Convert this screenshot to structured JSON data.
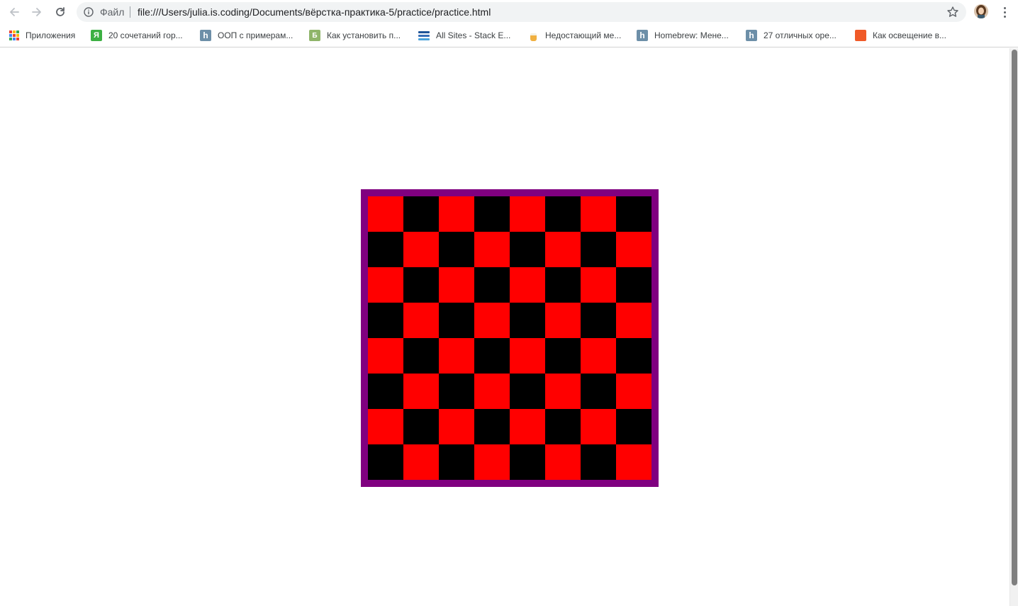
{
  "toolbar": {
    "scheme_label": "Файл",
    "url": "file:///Users/julia.is.coding/Documents/вёрстка-практика-5/practice/practice.html",
    "icons": {
      "back": "arrow-left",
      "forward": "arrow-right",
      "reload": "reload",
      "info": "info-circle",
      "bookmark": "star-outline",
      "profile": "avatar",
      "menu": "vertical-ellipsis"
    }
  },
  "bookmarks": [
    {
      "label": "Приложения",
      "icon": "apps-grid"
    },
    {
      "label": "20 сочетаний гор...",
      "icon": "green-y"
    },
    {
      "label": "ООП с примерам...",
      "icon": "habr-h"
    },
    {
      "label": "Как установить п...",
      "icon": "green-book"
    },
    {
      "label": "All Sites - Stack E...",
      "icon": "stack-exchange"
    },
    {
      "label": "Недостающий ме...",
      "icon": "beer-mug"
    },
    {
      "label": "Homebrew: Мене...",
      "icon": "habr-h"
    },
    {
      "label": "27 отличных ope...",
      "icon": "habr-h"
    },
    {
      "label": "Как освещение в...",
      "icon": "lifehacker"
    }
  ],
  "board": {
    "rows": 8,
    "cols": 8,
    "border_color": "#800080",
    "first_square_color": "#ff0000",
    "alternate_square_color": "#000000"
  }
}
